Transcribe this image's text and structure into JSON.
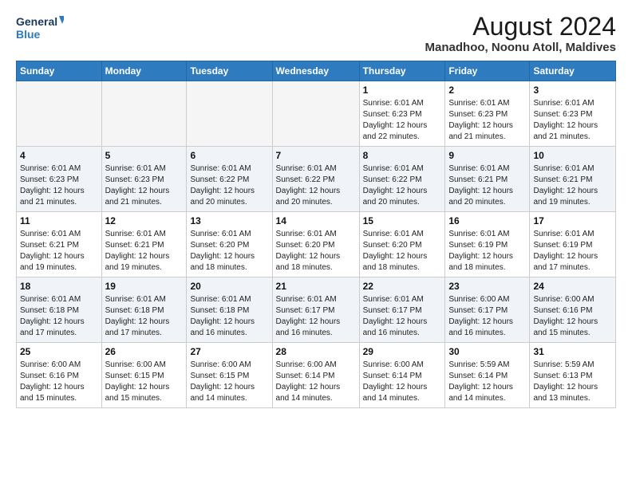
{
  "header": {
    "logo_line1": "General",
    "logo_line2": "Blue",
    "main_title": "August 2024",
    "subtitle": "Manadhoo, Noonu Atoll, Maldives"
  },
  "days_of_week": [
    "Sunday",
    "Monday",
    "Tuesday",
    "Wednesday",
    "Thursday",
    "Friday",
    "Saturday"
  ],
  "weeks": [
    [
      {
        "date": "",
        "info": ""
      },
      {
        "date": "",
        "info": ""
      },
      {
        "date": "",
        "info": ""
      },
      {
        "date": "",
        "info": ""
      },
      {
        "date": "1",
        "info": "Sunrise: 6:01 AM\nSunset: 6:23 PM\nDaylight: 12 hours\nand 22 minutes."
      },
      {
        "date": "2",
        "info": "Sunrise: 6:01 AM\nSunset: 6:23 PM\nDaylight: 12 hours\nand 21 minutes."
      },
      {
        "date": "3",
        "info": "Sunrise: 6:01 AM\nSunset: 6:23 PM\nDaylight: 12 hours\nand 21 minutes."
      }
    ],
    [
      {
        "date": "4",
        "info": "Sunrise: 6:01 AM\nSunset: 6:23 PM\nDaylight: 12 hours\nand 21 minutes."
      },
      {
        "date": "5",
        "info": "Sunrise: 6:01 AM\nSunset: 6:23 PM\nDaylight: 12 hours\nand 21 minutes."
      },
      {
        "date": "6",
        "info": "Sunrise: 6:01 AM\nSunset: 6:22 PM\nDaylight: 12 hours\nand 20 minutes."
      },
      {
        "date": "7",
        "info": "Sunrise: 6:01 AM\nSunset: 6:22 PM\nDaylight: 12 hours\nand 20 minutes."
      },
      {
        "date": "8",
        "info": "Sunrise: 6:01 AM\nSunset: 6:22 PM\nDaylight: 12 hours\nand 20 minutes."
      },
      {
        "date": "9",
        "info": "Sunrise: 6:01 AM\nSunset: 6:21 PM\nDaylight: 12 hours\nand 20 minutes."
      },
      {
        "date": "10",
        "info": "Sunrise: 6:01 AM\nSunset: 6:21 PM\nDaylight: 12 hours\nand 19 minutes."
      }
    ],
    [
      {
        "date": "11",
        "info": "Sunrise: 6:01 AM\nSunset: 6:21 PM\nDaylight: 12 hours\nand 19 minutes."
      },
      {
        "date": "12",
        "info": "Sunrise: 6:01 AM\nSunset: 6:21 PM\nDaylight: 12 hours\nand 19 minutes."
      },
      {
        "date": "13",
        "info": "Sunrise: 6:01 AM\nSunset: 6:20 PM\nDaylight: 12 hours\nand 18 minutes."
      },
      {
        "date": "14",
        "info": "Sunrise: 6:01 AM\nSunset: 6:20 PM\nDaylight: 12 hours\nand 18 minutes."
      },
      {
        "date": "15",
        "info": "Sunrise: 6:01 AM\nSunset: 6:20 PM\nDaylight: 12 hours\nand 18 minutes."
      },
      {
        "date": "16",
        "info": "Sunrise: 6:01 AM\nSunset: 6:19 PM\nDaylight: 12 hours\nand 18 minutes."
      },
      {
        "date": "17",
        "info": "Sunrise: 6:01 AM\nSunset: 6:19 PM\nDaylight: 12 hours\nand 17 minutes."
      }
    ],
    [
      {
        "date": "18",
        "info": "Sunrise: 6:01 AM\nSunset: 6:18 PM\nDaylight: 12 hours\nand 17 minutes."
      },
      {
        "date": "19",
        "info": "Sunrise: 6:01 AM\nSunset: 6:18 PM\nDaylight: 12 hours\nand 17 minutes."
      },
      {
        "date": "20",
        "info": "Sunrise: 6:01 AM\nSunset: 6:18 PM\nDaylight: 12 hours\nand 16 minutes."
      },
      {
        "date": "21",
        "info": "Sunrise: 6:01 AM\nSunset: 6:17 PM\nDaylight: 12 hours\nand 16 minutes."
      },
      {
        "date": "22",
        "info": "Sunrise: 6:01 AM\nSunset: 6:17 PM\nDaylight: 12 hours\nand 16 minutes."
      },
      {
        "date": "23",
        "info": "Sunrise: 6:00 AM\nSunset: 6:17 PM\nDaylight: 12 hours\nand 16 minutes."
      },
      {
        "date": "24",
        "info": "Sunrise: 6:00 AM\nSunset: 6:16 PM\nDaylight: 12 hours\nand 15 minutes."
      }
    ],
    [
      {
        "date": "25",
        "info": "Sunrise: 6:00 AM\nSunset: 6:16 PM\nDaylight: 12 hours\nand 15 minutes."
      },
      {
        "date": "26",
        "info": "Sunrise: 6:00 AM\nSunset: 6:15 PM\nDaylight: 12 hours\nand 15 minutes."
      },
      {
        "date": "27",
        "info": "Sunrise: 6:00 AM\nSunset: 6:15 PM\nDaylight: 12 hours\nand 14 minutes."
      },
      {
        "date": "28",
        "info": "Sunrise: 6:00 AM\nSunset: 6:14 PM\nDaylight: 12 hours\nand 14 minutes."
      },
      {
        "date": "29",
        "info": "Sunrise: 6:00 AM\nSunset: 6:14 PM\nDaylight: 12 hours\nand 14 minutes."
      },
      {
        "date": "30",
        "info": "Sunrise: 5:59 AM\nSunset: 6:14 PM\nDaylight: 12 hours\nand 14 minutes."
      },
      {
        "date": "31",
        "info": "Sunrise: 5:59 AM\nSunset: 6:13 PM\nDaylight: 12 hours\nand 13 minutes."
      }
    ]
  ]
}
